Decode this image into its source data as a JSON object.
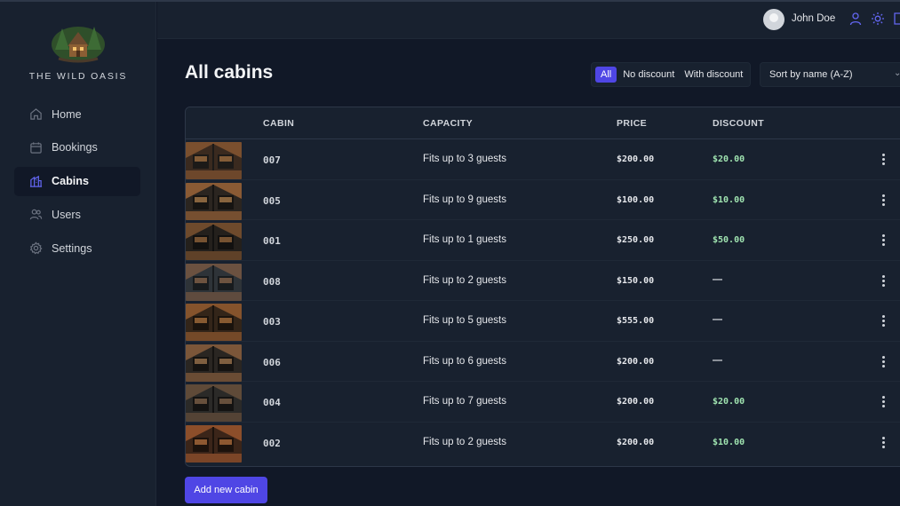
{
  "brand": {
    "name": "THE WILD OASIS"
  },
  "sidebar": {
    "items": [
      {
        "label": "Home",
        "icon": "home-icon",
        "active": false
      },
      {
        "label": "Bookings",
        "icon": "calendar-icon",
        "active": false
      },
      {
        "label": "Cabins",
        "icon": "building-icon",
        "active": true
      },
      {
        "label": "Users",
        "icon": "users-icon",
        "active": false
      },
      {
        "label": "Settings",
        "icon": "gear-icon",
        "active": false
      }
    ]
  },
  "header": {
    "username": "John Doe",
    "icons": [
      "user-icon",
      "sun-icon",
      "logout-icon"
    ]
  },
  "main": {
    "title": "All cabins",
    "filter": {
      "options": [
        "All",
        "No discount",
        "With discount"
      ],
      "selected": "All"
    },
    "sort": {
      "selected": "Sort by name (A-Z)"
    },
    "table": {
      "headers": [
        "",
        "CABIN",
        "CAPACITY",
        "PRICE",
        "DISCOUNT",
        ""
      ],
      "rows": [
        {
          "cabin": "007",
          "capacity": "Fits up to 3 guests",
          "price": "$200.00",
          "discount": "$20.00"
        },
        {
          "cabin": "005",
          "capacity": "Fits up to 9 guests",
          "price": "$100.00",
          "discount": "$10.00"
        },
        {
          "cabin": "001",
          "capacity": "Fits up to 1 guests",
          "price": "$250.00",
          "discount": "$50.00"
        },
        {
          "cabin": "008",
          "capacity": "Fits up to 2 guests",
          "price": "$150.00",
          "discount": "—"
        },
        {
          "cabin": "003",
          "capacity": "Fits up to 5 guests",
          "price": "$555.00",
          "discount": "—"
        },
        {
          "cabin": "006",
          "capacity": "Fits up to 6 guests",
          "price": "$200.00",
          "discount": "—"
        },
        {
          "cabin": "004",
          "capacity": "Fits up to 7 guests",
          "price": "$200.00",
          "discount": "$20.00"
        },
        {
          "cabin": "002",
          "capacity": "Fits up to 2 guests",
          "price": "$200.00",
          "discount": "$10.00"
        }
      ]
    },
    "add_button": "Add new cabin"
  },
  "colors": {
    "accent": "#4f46e5",
    "discount": "#9fe3b0",
    "background": "#111827",
    "panel": "#18212f"
  }
}
